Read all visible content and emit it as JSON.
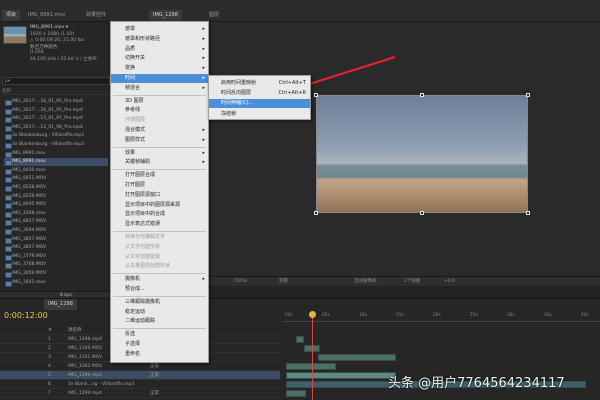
{
  "tabs": {
    "left": [
      "项目",
      "IMG_8991.mov",
      "项目",
      "效果控件",
      "IMG_1298.mp4"
    ],
    "right": [
      "合成",
      "IMG_1298",
      "图层",
      "(无)"
    ]
  },
  "project": {
    "selected_name": "IMG_8991.mov ▾",
    "meta": [
      "1920 x 1080 (1.00)",
      "△ 0:00:09:20, 25.00 fps",
      "数百万种颜色",
      "H.264",
      "44.100 kHz / 32 bit U / 立体声"
    ],
    "search_placeholder": "ρ▾",
    "column_header": "名称",
    "files": [
      "IMG_2017-...18_01_95_Pro.mp4",
      "IMG_2017-...18_01_95_Pro.mp4",
      "IMG_2017-...13_01_97_Pro.mp4",
      "IMG_2017-...13_01_98_Pro.mp4",
      "3x Blankenburg - Villandflo.mp3",
      "3x Blankenburg - Villandflo.mp3",
      "IMG_8991.mov",
      "IMG_8991.mov",
      "IMG_8450.mov",
      "IMG_8451.MOV",
      "IMG_8258.MOV",
      "IMG_8250.MOV",
      "IMG_8495.MOV",
      "IMG_3348.mov",
      "IMG_8457.MOV",
      "IMG_3694.MOV",
      "IMG_3857.MOV",
      "IMG_3857.MOV",
      "IMG_3779.MOV",
      "IMG_3768.MOV",
      "IMG_3059.MOV",
      "IMG_3441.mov"
    ],
    "selected_index": 7,
    "footer": "8 bpc"
  },
  "viewer_bar": [
    "(50%)",
    "完整",
    "活动摄像机",
    "1个视图",
    "+0.0"
  ],
  "timeline": {
    "tab": "IMG_1298",
    "timecode": "0:00:12:00",
    "col_headers": [
      "#",
      "源名称",
      "模式",
      "T",
      "TrkMat"
    ],
    "ruler": [
      "00s",
      "05s",
      "10s",
      "15s",
      "20s",
      "25s",
      "30s",
      "35s",
      "40s"
    ],
    "layers": [
      {
        "num": "1",
        "name": "IMG_1298.mp4",
        "mode": "正常"
      },
      {
        "num": "2",
        "name": "IMG_1300.MOV",
        "mode": "正常"
      },
      {
        "num": "3",
        "name": "IMG_1301.MOV",
        "mode": "正常"
      },
      {
        "num": "4",
        "name": "IMG_1302.MOV",
        "mode": "正常"
      },
      {
        "num": "5",
        "name": "IMG_1299.mp4",
        "mode": "正常"
      },
      {
        "num": "6",
        "name": "3x Blank...ng - Villandflo.mp3",
        "mode": ""
      },
      {
        "num": "7",
        "name": "IMG_1299.mp4",
        "mode": "正常"
      }
    ],
    "selected_index": 4
  },
  "context_menu": [
    {
      "label": "遮罩",
      "arrow": true
    },
    {
      "label": "遮罩和形状路径",
      "arrow": true
    },
    {
      "label": "品质",
      "arrow": true
    },
    {
      "label": "切换开关",
      "arrow": true
    },
    {
      "label": "变换",
      "arrow": true
    },
    {
      "label": "时间",
      "arrow": true,
      "hi": true
    },
    {
      "label": "帧混合",
      "arrow": true
    },
    {
      "label": "3D 图层",
      "sep_before": true
    },
    {
      "label": "参考线"
    },
    {
      "label": "环境图层",
      "dis": true
    },
    {
      "label": "混合模式",
      "arrow": true
    },
    {
      "label": "图层样式",
      "arrow": true
    },
    {
      "label": "效果",
      "arrow": true,
      "sep_before": true
    },
    {
      "label": "关键帧辅助",
      "arrow": true
    },
    {
      "label": "打开图层合成",
      "sep_before": true
    },
    {
      "label": "打开图层"
    },
    {
      "label": "打开图层源窗口"
    },
    {
      "label": "显示项目中的图层源来源"
    },
    {
      "label": "显示项目中的合成"
    },
    {
      "label": "显示表达式错误"
    },
    {
      "label": "转换为可编辑文字",
      "dis": true,
      "sep_before": true
    },
    {
      "label": "从文字创建形状",
      "dis": true
    },
    {
      "label": "从文字创建蒙版",
      "dis": true
    },
    {
      "label": "从矢量图层创建形状",
      "dis": true
    },
    {
      "label": "摄像机",
      "arrow": true,
      "sep_before": true
    },
    {
      "label": "预合成..."
    },
    {
      "label": "三维跟踪摄像机",
      "sep_before": true
    },
    {
      "label": "稳定运动"
    },
    {
      "label": "二维运动跟踪"
    },
    {
      "label": "反选",
      "sep_before": true
    },
    {
      "label": "子选择"
    },
    {
      "label": "重命名"
    }
  ],
  "submenu": [
    {
      "label": "启用时间重映射",
      "shortcut": "Ctrl+Alt+T"
    },
    {
      "label": "时间反向图层",
      "shortcut": "Ctrl+Alt+R"
    },
    {
      "label": "时间伸缩(C)...",
      "shortcut": "",
      "hi": true
    },
    {
      "label": "冻结帧",
      "shortcut": ""
    }
  ],
  "annotation_color": "#e8202a",
  "watermark": "头条 @用户7764564234117"
}
